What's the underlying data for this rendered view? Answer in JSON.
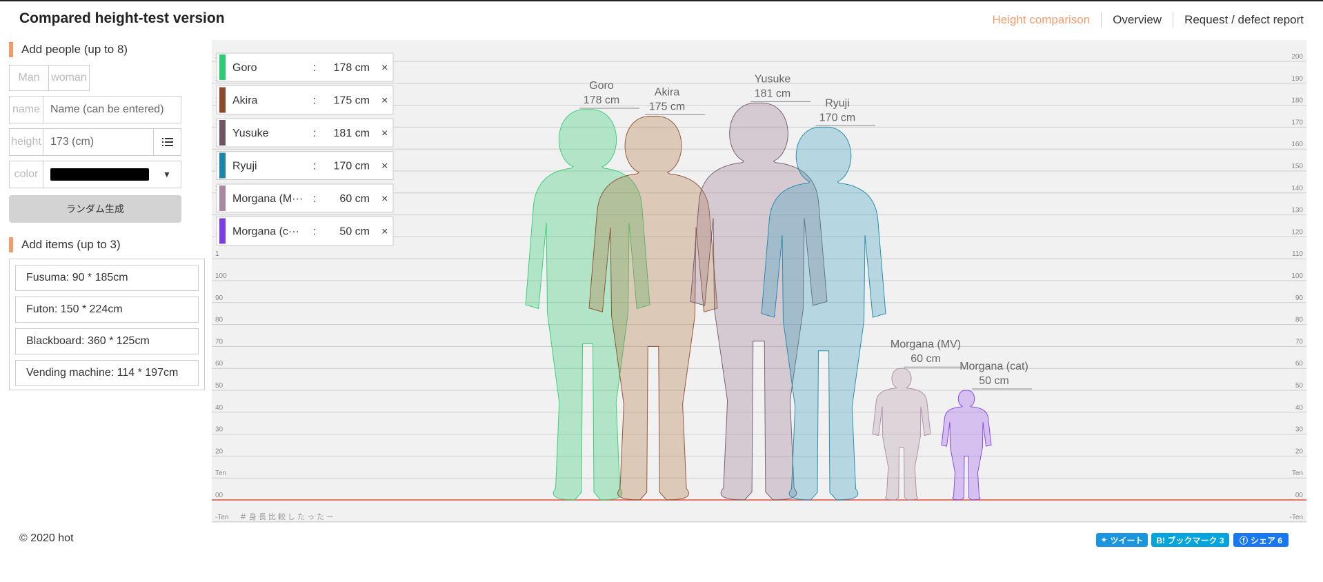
{
  "header": {
    "title": "Compared height-test version",
    "nav": [
      "Height comparison",
      "Overview",
      "Request / defect report"
    ]
  },
  "sidebar": {
    "add_people_title": "Add people (up to 8)",
    "gender_buttons": [
      "Man",
      "woman"
    ],
    "name_label": "name",
    "name_placeholder": "Name (can be entered)",
    "height_label": "height",
    "height_placeholder": "173 (cm)",
    "color_label": "color",
    "random_button": "ランダム生成",
    "add_items_title": "Add items (up to 3)",
    "items": [
      "Fusuma: 90 * 185cm",
      "Futon: 150 * 224cm",
      "Blackboard: 360 * 125cm",
      "Vending machine: 114 * 197cm"
    ]
  },
  "people": [
    {
      "name": "Goro",
      "list_name": "Goro",
      "height": 178,
      "height_label": "178 cm",
      "color": "#2ecc71"
    },
    {
      "name": "Akira",
      "list_name": "Akira",
      "height": 175,
      "height_label": "175 cm",
      "color": "#8b4a2b"
    },
    {
      "name": "Yusuke",
      "list_name": "Yusuke",
      "height": 181,
      "height_label": "181 cm",
      "color": "#6e5666"
    },
    {
      "name": "Ryuji",
      "list_name": "Ryuji",
      "height": 170,
      "height_label": "170 cm",
      "color": "#1a86a8"
    },
    {
      "name": "Morgana (MV)",
      "list_name": "Morgana (M···",
      "height": 60,
      "height_label": "60 cm",
      "color": "#a88aa0"
    },
    {
      "name": "Morgana (cat)",
      "list_name": "Morgana (c···",
      "height": 50,
      "height_label": "50 cm",
      "color": "#7d3fe0"
    }
  ],
  "list_separator": ":",
  "remove_glyph": "×",
  "scale": {
    "left_labels": [
      "200",
      "1",
      "1",
      "1",
      "1",
      "1",
      "1",
      "1",
      "1",
      "1",
      "100",
      "90",
      "80",
      "70",
      "60",
      "50",
      "40",
      "30",
      "20",
      "Ten",
      "00",
      "-Ten"
    ],
    "right_labels": [
      "200",
      "190",
      "180",
      "170",
      "160",
      "150",
      "140",
      "130",
      "120",
      "110",
      "100",
      "90",
      "80",
      "70",
      "60",
      "50",
      "40",
      "30",
      "20",
      "Ten",
      "00",
      "-Ten"
    ]
  },
  "hashtag": "＃身長比較したったー",
  "footer": {
    "copyright": "© 2020 hot",
    "tweet": "ツイート",
    "bookmark": "B! ブックマーク 3",
    "share": "シェア 6"
  },
  "colors": {
    "accent": "#f39b6b",
    "baseline": "#e74c3c",
    "chart_bg": "#f1f1f1",
    "grid": "#cccccc"
  }
}
